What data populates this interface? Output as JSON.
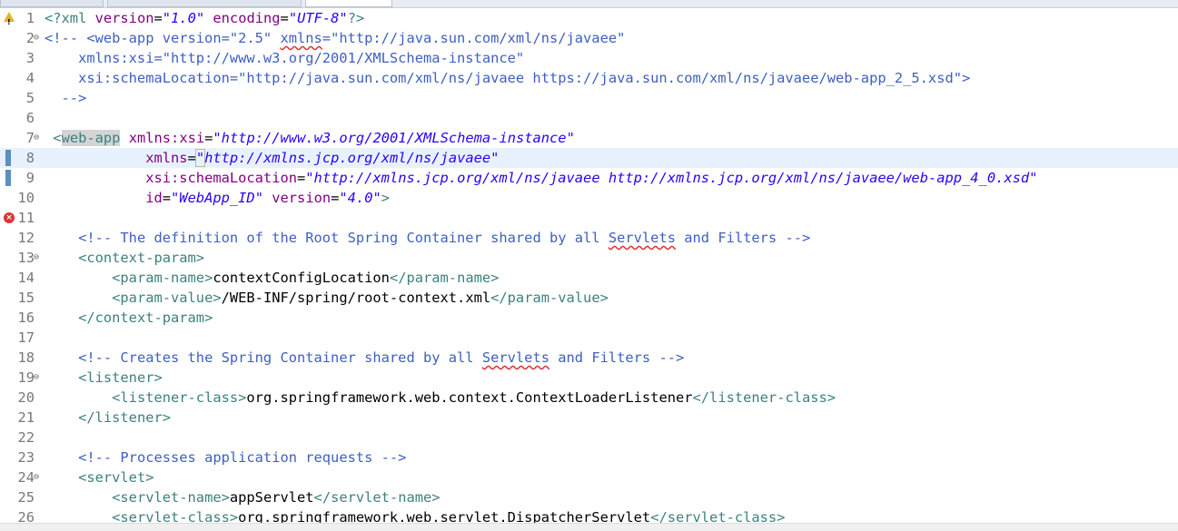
{
  "lines": [
    {
      "num": "1",
      "marker": "warning",
      "segs": [
        [
          "ptag",
          "<?xml "
        ],
        [
          "aname",
          "version"
        ],
        [
          "txt",
          "="
        ],
        [
          "aval",
          "\"1.0\""
        ],
        [
          "txt",
          " "
        ],
        [
          "aname",
          "encoding"
        ],
        [
          "txt",
          "="
        ],
        [
          "aval",
          "\"UTF-8\""
        ],
        [
          "ptag",
          "?>"
        ]
      ]
    },
    {
      "num": "2",
      "fold": true,
      "segs": [
        [
          "cmt",
          "<!-- <web-app version=\"2.5\" "
        ],
        [
          "cmt squig",
          "xmlns"
        ],
        [
          "cmt",
          "=\"http://java.sun.com/xml/ns/javaee\""
        ]
      ]
    },
    {
      "num": "3",
      "segs": [
        [
          "cmt",
          "    xmlns:xsi=\"http://www.w3.org/2001/XMLSchema-instance\""
        ]
      ]
    },
    {
      "num": "4",
      "segs": [
        [
          "cmt",
          "    xsi:schemaLocation=\"http://java.sun.com/xml/ns/javaee https://java.sun.com/xml/ns/javaee/web-app_2_5.xsd\">"
        ]
      ]
    },
    {
      "num": "5",
      "segs": [
        [
          "cmt",
          "  -->"
        ]
      ]
    },
    {
      "num": "6",
      "segs": []
    },
    {
      "num": "7",
      "fold": true,
      "segs": [
        [
          "txt",
          " "
        ],
        [
          "ptag",
          "<"
        ],
        [
          "ptag sel",
          "web-app"
        ],
        [
          "txt",
          " "
        ],
        [
          "aname",
          "xmlns:xsi"
        ],
        [
          "txt",
          "="
        ],
        [
          "aval",
          "\"http://www.w3.org/2001/XMLSchema-instance\""
        ]
      ]
    },
    {
      "num": "8",
      "marker": "change",
      "highlight": true,
      "segs": [
        [
          "txt",
          "            "
        ],
        [
          "aname",
          "xmlns"
        ],
        [
          "txt",
          "="
        ],
        [
          "aval caretbox",
          "\""
        ],
        [
          "aval",
          "http://xmlns.jcp.org/xml/ns/javaee\""
        ]
      ]
    },
    {
      "num": "9",
      "marker": "change",
      "segs": [
        [
          "txt",
          "            "
        ],
        [
          "aname",
          "xsi:schemaLocation"
        ],
        [
          "txt",
          "="
        ],
        [
          "aval",
          "\"http://xmlns.jcp.org/xml/ns/javaee http://xmlns.jcp.org/xml/ns/javaee/web-app_4_0.xsd\""
        ]
      ]
    },
    {
      "num": "10",
      "segs": [
        [
          "txt",
          "            "
        ],
        [
          "aname",
          "id"
        ],
        [
          "txt",
          "="
        ],
        [
          "aval",
          "\"WebApp_ID\""
        ],
        [
          "txt",
          " "
        ],
        [
          "aname",
          "version"
        ],
        [
          "txt",
          "="
        ],
        [
          "aval",
          "\"4.0\""
        ],
        [
          "ptag",
          ">"
        ]
      ]
    },
    {
      "num": "11",
      "marker": "error",
      "segs": []
    },
    {
      "num": "12",
      "segs": [
        [
          "txt",
          "    "
        ],
        [
          "cmt",
          "<!-- The definition of the Root Spring Container shared by all "
        ],
        [
          "cmt squig",
          "Servlets"
        ],
        [
          "cmt",
          " and Filters -->"
        ]
      ]
    },
    {
      "num": "13",
      "fold": true,
      "segs": [
        [
          "txt",
          "    "
        ],
        [
          "ptag",
          "<context-param>"
        ]
      ]
    },
    {
      "num": "14",
      "segs": [
        [
          "txt",
          "        "
        ],
        [
          "ptag",
          "<param-name>"
        ],
        [
          "txt",
          "contextConfigLocation"
        ],
        [
          "ptag",
          "</param-name>"
        ]
      ]
    },
    {
      "num": "15",
      "segs": [
        [
          "txt",
          "        "
        ],
        [
          "ptag",
          "<param-value>"
        ],
        [
          "txt",
          "/WEB-INF/spring/root-context.xml"
        ],
        [
          "ptag",
          "</param-value>"
        ]
      ]
    },
    {
      "num": "16",
      "segs": [
        [
          "txt",
          "    "
        ],
        [
          "ptag",
          "</context-param>"
        ]
      ]
    },
    {
      "num": "17",
      "segs": []
    },
    {
      "num": "18",
      "segs": [
        [
          "txt",
          "    "
        ],
        [
          "cmt",
          "<!-- Creates the Spring Container shared by all "
        ],
        [
          "cmt squig",
          "Servlets"
        ],
        [
          "cmt",
          " and Filters -->"
        ]
      ]
    },
    {
      "num": "19",
      "fold": true,
      "segs": [
        [
          "txt",
          "    "
        ],
        [
          "ptag",
          "<listener>"
        ]
      ]
    },
    {
      "num": "20",
      "segs": [
        [
          "txt",
          "        "
        ],
        [
          "ptag",
          "<listener-class>"
        ],
        [
          "txt",
          "org.springframework.web.context.ContextLoaderListener"
        ],
        [
          "ptag",
          "</listener-class>"
        ]
      ]
    },
    {
      "num": "21",
      "segs": [
        [
          "txt",
          "    "
        ],
        [
          "ptag",
          "</listener>"
        ]
      ]
    },
    {
      "num": "22",
      "segs": []
    },
    {
      "num": "23",
      "segs": [
        [
          "txt",
          "    "
        ],
        [
          "cmt",
          "<!-- Processes application requests -->"
        ]
      ]
    },
    {
      "num": "24",
      "fold": true,
      "segs": [
        [
          "txt",
          "    "
        ],
        [
          "ptag",
          "<servlet>"
        ]
      ]
    },
    {
      "num": "25",
      "segs": [
        [
          "txt",
          "        "
        ],
        [
          "ptag",
          "<servlet-name>"
        ],
        [
          "txt",
          "appServlet"
        ],
        [
          "ptag",
          "</servlet-name>"
        ]
      ]
    },
    {
      "num": "26",
      "segs": [
        [
          "txt",
          "        "
        ],
        [
          "ptag",
          "<servlet-class>"
        ],
        [
          "txt",
          "org.springframework.web.servlet.DispatcherServlet"
        ],
        [
          "ptag",
          "</servlet-class>"
        ]
      ]
    }
  ]
}
